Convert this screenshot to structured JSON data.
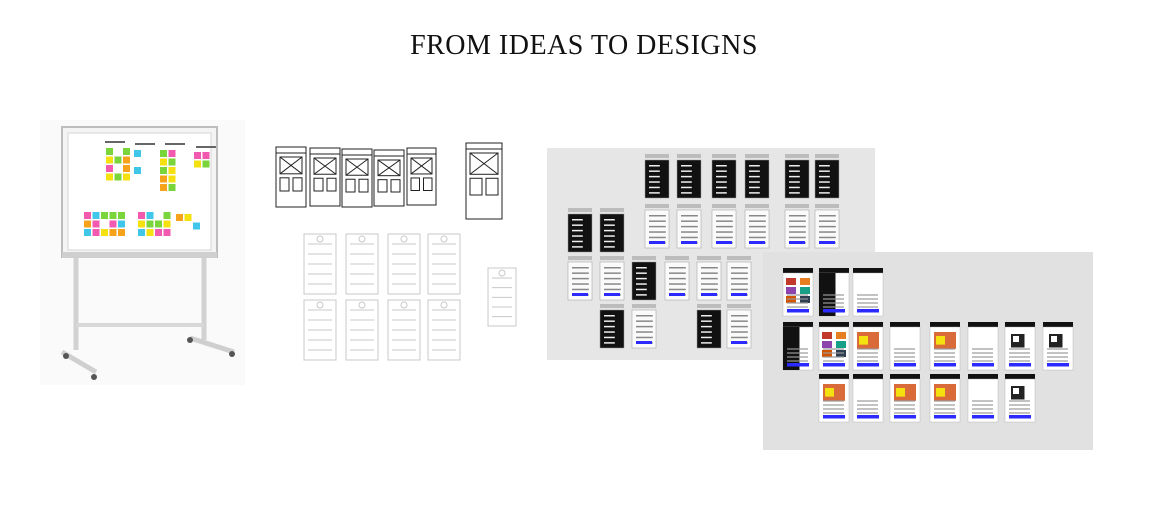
{
  "title": "FROM IDEAS TO DESIGNS",
  "colors": {
    "background": "#ffffff",
    "panel_gray": "#e6e6e6",
    "accent_blue": "#2b2bff",
    "note_yellow": "#f5e10f",
    "note_orange": "#f7a21b",
    "note_green": "#7ad53a",
    "note_pink": "#f25ab0",
    "note_cyan": "#3fc6e8"
  },
  "icons": [
    "whiteboard-icon",
    "wireframe-sketch-icon",
    "mobile-screen-icon"
  ]
}
